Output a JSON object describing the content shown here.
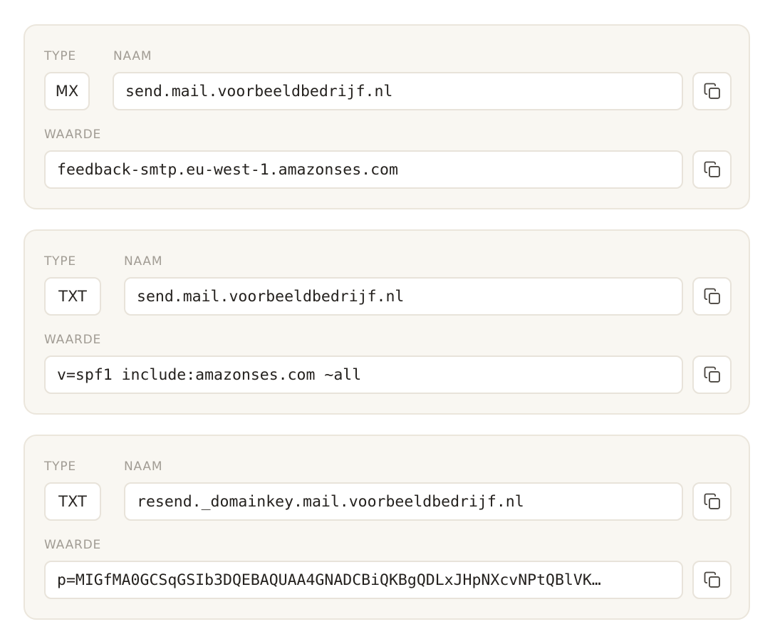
{
  "labels": {
    "type": "TYPE",
    "name": "NAAM",
    "value": "WAARDE"
  },
  "records": [
    {
      "type": "MX",
      "name": "send.mail.voorbeeldbedrijf.nl",
      "value": "feedback-smtp.eu-west-1.amazonses.com"
    },
    {
      "type": "TXT",
      "name": "send.mail.voorbeeldbedrijf.nl",
      "value": "v=spf1 include:amazonses.com ~all"
    },
    {
      "type": "TXT",
      "name": "resend._domainkey.mail.voorbeeldbedrijf.nl",
      "value": "p=MIGfMA0GCSqGSIb3DQEBAQUAA4GNADCBiQKBgQDLxJHpNXcvNPtQBlVK…"
    }
  ],
  "icons": {
    "copy": "copy-icon"
  }
}
